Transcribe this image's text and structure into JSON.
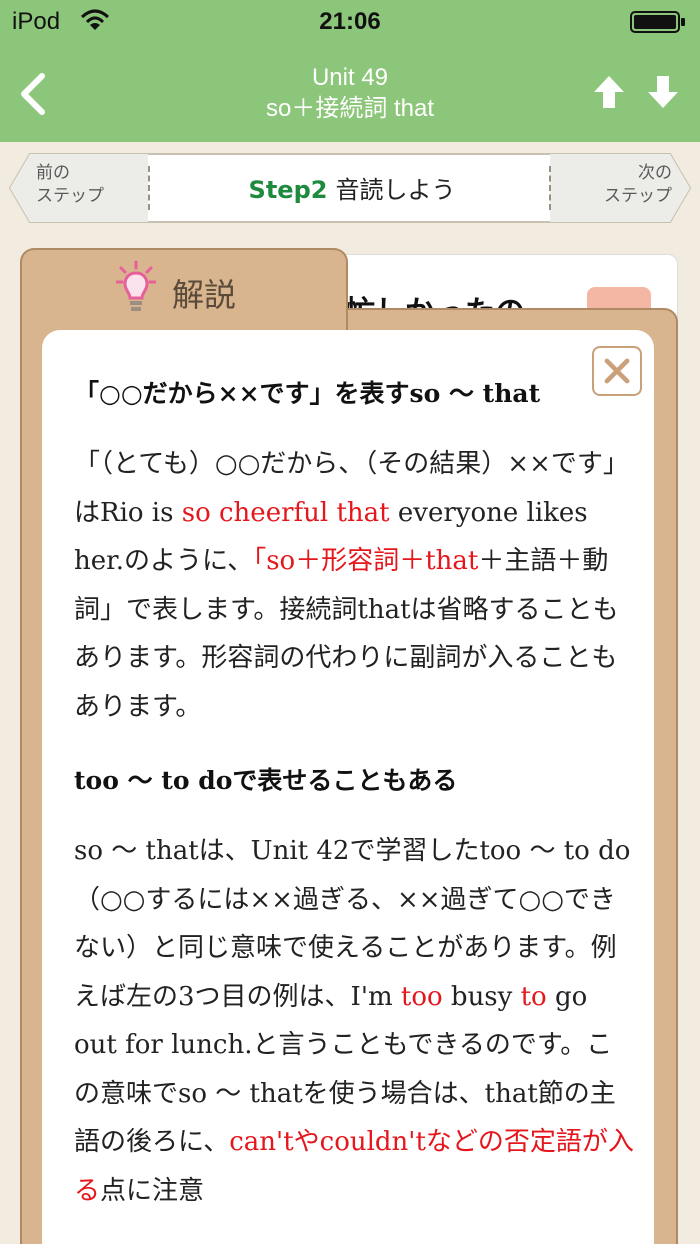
{
  "status_bar": {
    "carrier": "iPod",
    "time": "21:06"
  },
  "nav": {
    "unit": "Unit 49",
    "topic": "so＋接続詞 that"
  },
  "step_bar": {
    "prev_line1": "前の",
    "prev_line2": "ステップ",
    "next_line1": "次の",
    "next_line2": "ステップ",
    "step_number": "Step2",
    "step_title": "音読しよう"
  },
  "background_card": {
    "text": "忙しかったの"
  },
  "panel": {
    "tab_label": "解説",
    "heading1": "「○○だから××です」を表すso 〜 that",
    "p1": {
      "s1": "「（とても）○○だから、（その結果）××です」はRio is ",
      "r1": "so cheerful that",
      "s2": " everyone likes her.のように、",
      "r2": "「so＋形容詞＋that",
      "s3": "＋主語＋動詞」で表します。接続詞thatは省略することもあります。形容詞の代わりに副詞が入ることもあります。"
    },
    "heading2": "too 〜 to doで表せることもある",
    "p2": {
      "s1": "so 〜 thatは、Unit 42で学習したtoo 〜 to do（○○するには××過ぎる、××過ぎて○○できない）と同じ意味で使えることがあります。例えば左の3つ目の例は、I'm ",
      "r1": "too",
      "s2": " busy ",
      "r2": "to",
      "s3": " go out for lunch.と言うこともできるのです。この意味でso 〜 thatを使う場合は、that節の主語の後ろに、",
      "r3": "can'tやcouldn'tなどの否定語が入る",
      "s4": "点に注意"
    }
  },
  "colors": {
    "nav_green": "#8cc67a",
    "step_green": "#1e8a3d",
    "highlight_red": "#e5161c",
    "panel_tan": "#d8b58e"
  }
}
